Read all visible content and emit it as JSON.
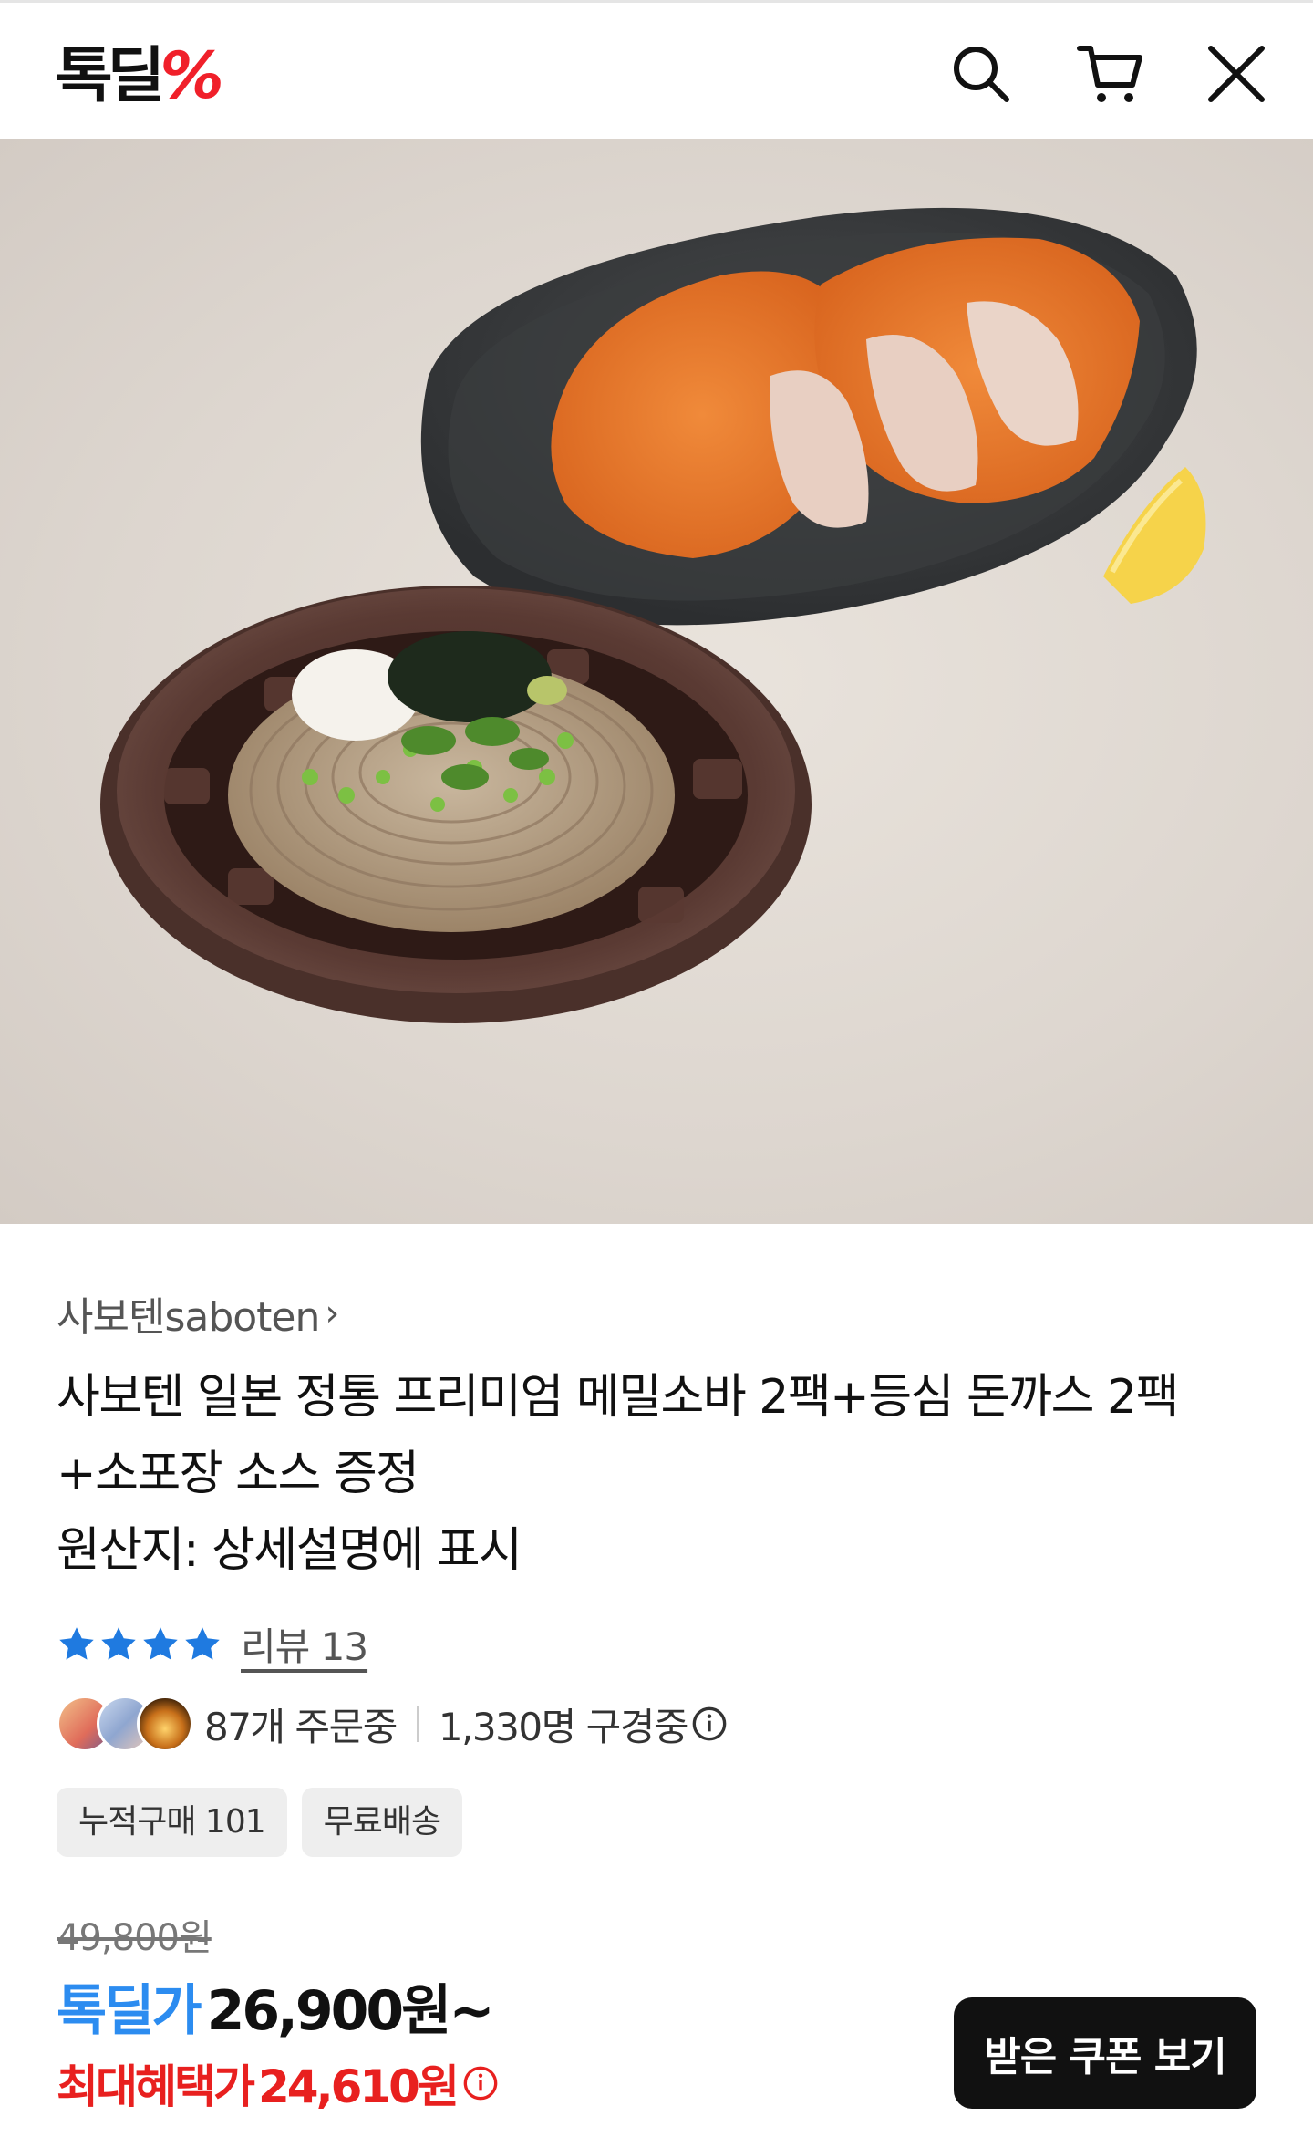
{
  "header": {
    "logo_text": "톡딜",
    "logo_mark": "%",
    "icons": [
      "search-icon",
      "cart-icon",
      "close-icon"
    ]
  },
  "hero": {
    "image": "photo of soba noodles bowl and pork cutlet plate"
  },
  "product": {
    "brand": "사보텐saboten",
    "brand_chevron": "›",
    "title": "사보텐 일본 정통 프리미엄 메밀소바 2팩+등심 돈까스 2팩 +소포장 소스 증정",
    "origin": "원산지: 상세설명에 표시",
    "rating_stars": 4,
    "review_label": "리뷰 13",
    "orders_text": "87개 주문중",
    "viewers_text": "1,330명 구경중",
    "chips": [
      "누적구매 101",
      "무료배송"
    ],
    "original_price": "49,800원",
    "deal_label": "톡딜가",
    "deal_price": "26,900원~",
    "max_label": "최대혜택가",
    "max_price": "24,610원",
    "coupon_button": "받은 쿠폰 보기"
  },
  "colors": {
    "brand_red": "#f0202a",
    "deal_blue": "#2c8cf0",
    "star_blue": "#1f7ae0",
    "benefit_red": "#e8201f"
  }
}
